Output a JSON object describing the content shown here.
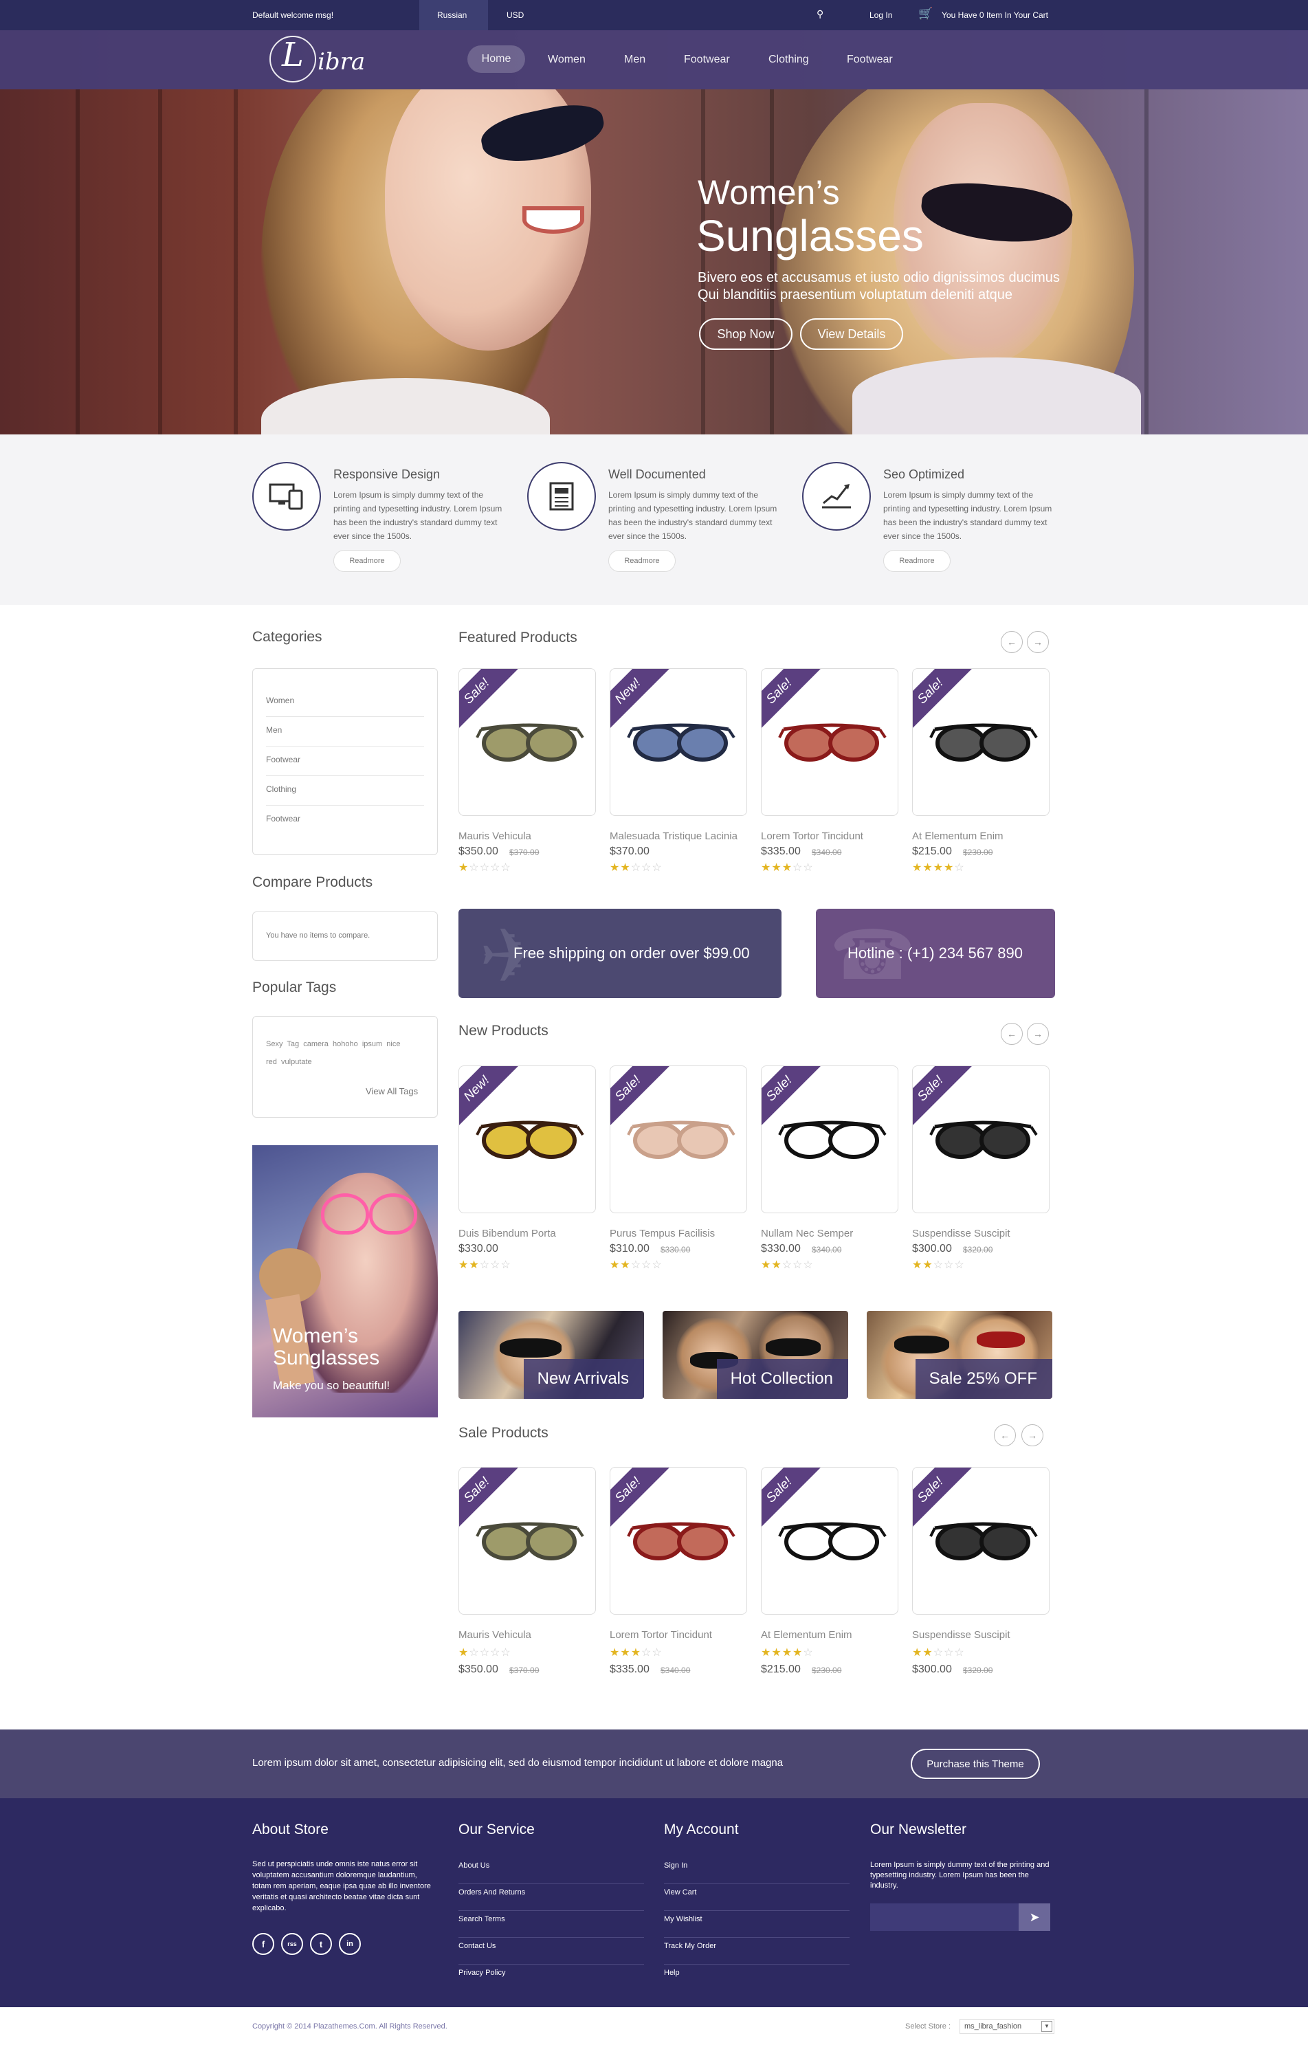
{
  "topbar": {
    "welcome": "Default welcome msg!",
    "language": "Russian",
    "currency": "USD",
    "login": "Log In",
    "cart": "You Have 0 Item In Your Cart"
  },
  "header": {
    "logo_letter": "L",
    "logo_text": "ibra",
    "nav": [
      "Home",
      "Women",
      "Men",
      "Footwear",
      "Clothing",
      "Footwear"
    ]
  },
  "hero": {
    "title1": "Women’s",
    "title2": "Sunglasses",
    "subtitle1": "Bivero eos et accusamus et iusto odio dignissimos ducimus",
    "subtitle2": "Qui blanditiis praesentium voluptatum deleniti atque",
    "btn_shop": "Shop Now",
    "btn_details": "View Details"
  },
  "features": [
    {
      "title": "Responsive Design",
      "text": "Lorem Ipsum is simply dummy text of the printing and typesetting industry. Lorem Ipsum has been the industry's standard dummy text ever since the 1500s.",
      "button": "Readmore",
      "icon": "devices-icon"
    },
    {
      "title": "Well Documented",
      "text": "Lorem Ipsum is simply dummy text of the printing and typesetting industry. Lorem Ipsum has been the industry's standard dummy text ever since the 1500s.",
      "button": "Readmore",
      "icon": "document-icon"
    },
    {
      "title": "Seo Optimized",
      "text": "Lorem Ipsum is simply dummy text of the printing and typesetting industry. Lorem Ipsum has been the industry's standard dummy text ever since the 1500s.",
      "button": "Readmore",
      "icon": "growth-chart-icon"
    }
  ],
  "sidebar": {
    "categories_title": "Categories",
    "categories": [
      "Women",
      "Men",
      "Footwear",
      "Clothing",
      "Footwear"
    ],
    "compare_title": "Compare Products",
    "compare_text": "You have no items to compare.",
    "tags_title": "Popular Tags",
    "tags_line1": "Sexy  Tag  camera  hohoho  ipsum  nice",
    "tags_line2": "red  vulputate",
    "view_all": "View All Tags",
    "promo_title1": "Women’s",
    "promo_title2": "Sunglasses",
    "promo_sub": "Make you so beautiful!"
  },
  "featured": {
    "title": "Featured Products",
    "items": [
      {
        "badge": "Sale!",
        "name": "Mauris Vehicula",
        "price": "$350.00",
        "old": "$370.00",
        "rating": 1
      },
      {
        "badge": "New!",
        "name": "Malesuada Tristique Lacinia",
        "price": "$370.00",
        "old": "",
        "rating": 2
      },
      {
        "badge": "Sale!",
        "name": "Lorem Tortor Tincidunt",
        "price": "$335.00",
        "old": "$340.00",
        "rating": 3
      },
      {
        "badge": "Sale!",
        "name": "At Elementum Enim",
        "price": "$215.00",
        "old": "$230.00",
        "rating": 4
      }
    ]
  },
  "banners": {
    "shipping": "Free shipping on order over $99.00",
    "hotline": "Hotline : (+1) 234 567 890"
  },
  "new_products": {
    "title": "New Products",
    "items": [
      {
        "badge": "New!",
        "name": "Duis Bibendum Porta",
        "price": "$330.00",
        "old": "",
        "rating": 2
      },
      {
        "badge": "Sale!",
        "name": "Purus Tempus Facilisis",
        "price": "$310.00",
        "old": "$330.00",
        "rating": 2
      },
      {
        "badge": "Sale!",
        "name": "Nullam Nec Semper",
        "price": "$330.00",
        "old": "$340.00",
        "rating": 2
      },
      {
        "badge": "Sale!",
        "name": "Suspendisse Suscipit",
        "price": "$300.00",
        "old": "$320.00",
        "rating": 2
      }
    ]
  },
  "collections": [
    "New Arrivals",
    "Hot Collection",
    "Sale 25% OFF"
  ],
  "sale_products": {
    "title": "Sale Products",
    "items": [
      {
        "badge": "Sale!",
        "name": "Mauris Vehicula",
        "price": "$350.00",
        "old": "$370.00",
        "rating": 1
      },
      {
        "badge": "Sale!",
        "name": "Lorem Tortor Tincidunt",
        "price": "$335.00",
        "old": "$340.00",
        "rating": 3
      },
      {
        "badge": "Sale!",
        "name": "At Elementum Enim",
        "price": "$215.00",
        "old": "$230.00",
        "rating": 4
      },
      {
        "badge": "Sale!",
        "name": "Suspendisse Suscipit",
        "price": "$300.00",
        "old": "$320.00",
        "rating": 2
      }
    ]
  },
  "purchase": {
    "text": "Lorem ipsum dolor sit amet, consectetur adipisicing elit, sed do eiusmod tempor incididunt ut labore et dolore magna",
    "button": "Purchase this Theme"
  },
  "footer": {
    "about_title": "About Store",
    "about_text": "Sed ut perspiciatis unde omnis iste natus error sit voluptatem accusantium doloremque laudantium, totam rem aperiam, eaque ipsa quae ab illo inventore veritatis et quasi architecto beatae vitae dicta sunt explicabo.",
    "service_title": "Our Service",
    "service_links": [
      "About Us",
      "Orders And Returns",
      "Search Terms",
      "Contact Us",
      "Privacy Policy"
    ],
    "account_title": "My Account",
    "account_links": [
      "Sign In",
      "View Cart",
      "My Wishlist",
      "Track My Order",
      "Help"
    ],
    "newsletter_title": "Our Newsletter",
    "newsletter_text": "Lorem Ipsum is simply dummy text of the printing and typesetting industry. Lorem Ipsum has been the industry.",
    "social": [
      "f",
      "rss",
      "t",
      "in"
    ]
  },
  "bottom": {
    "copyright": "Copyright © 2014 Plazathemes.Com. All Rights Reserved.",
    "store_label": "Select Store :",
    "store_value": "ms_libra_fashion"
  }
}
